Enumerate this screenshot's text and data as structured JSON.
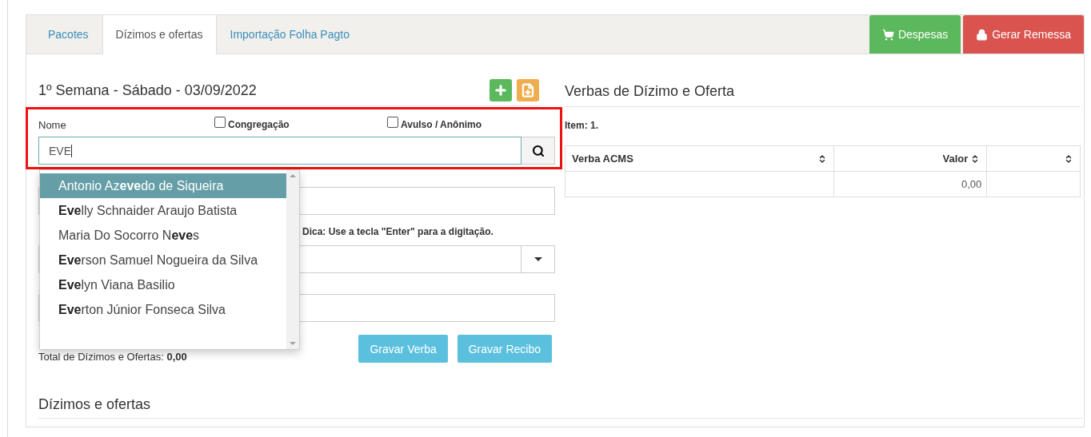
{
  "tabs": [
    {
      "label": "Pacotes",
      "selected": false
    },
    {
      "label": "Dízimos e ofertas",
      "selected": true
    },
    {
      "label": "Importação Folha Pagto",
      "selected": false
    }
  ],
  "actions": [
    {
      "label": "Despesas",
      "kind": "expenses"
    },
    {
      "label": "Gerar Remessa",
      "kind": "remittance"
    }
  ],
  "week_title": "1º Semana - Sábado - 03/09/2022",
  "form": {
    "name_label": "Nome",
    "checkboxes": [
      {
        "label": "Congregação",
        "checked": false
      },
      {
        "label": "Avulso / Anônimo",
        "checked": false
      }
    ],
    "name_value": "EVE",
    "suggestions": [
      {
        "text": "Antonio Az**eve**do de Siqueira",
        "selected": true
      },
      {
        "text": "**Eve**lly Schnaider Araujo Batista",
        "selected": false
      },
      {
        "text": "Maria Do Socorro N**eve**s",
        "selected": false
      },
      {
        "text": "**Eve**rson Samuel Nogueira da Silva",
        "selected": false
      },
      {
        "text": "**Eve**lyn Viana Basilio",
        "selected": false
      },
      {
        "text": "**Eve**rton Júnior Fonseca Silva",
        "selected": false
      }
    ],
    "hint": "Dica: Use a tecla \"Enter\" para a digitação.",
    "buttons": [
      "Gravar Verba",
      "Gravar Recibo"
    ],
    "total_label": "Total de Dízimos e Ofertas:",
    "total_value": "0,00"
  },
  "section_title": "Dízimos e ofertas",
  "verbas": {
    "title": "Verbas de Dízimo e Oferta",
    "item_label": "Item: 1.",
    "columns": [
      "Verba ACMS",
      "Valor"
    ],
    "rows": [
      {
        "valor": "0,00"
      }
    ]
  }
}
